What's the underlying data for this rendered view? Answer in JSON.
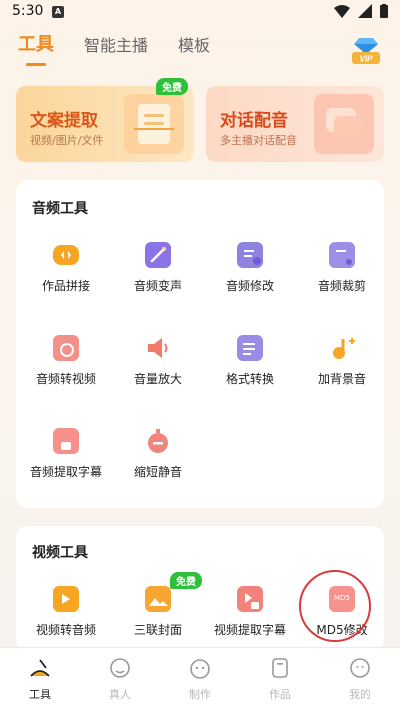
{
  "status": {
    "time": "5:30",
    "notif": "A"
  },
  "tabs": [
    {
      "label": "工具",
      "active": true
    },
    {
      "label": "智能主播"
    },
    {
      "label": "模板"
    }
  ],
  "vip": {
    "label": "VIP"
  },
  "features": [
    {
      "title": "文案提取",
      "subtitle": "视频/图片/文件",
      "badge": "免费"
    },
    {
      "title": "对话配音",
      "subtitle": "多主播对话配音"
    }
  ],
  "audio_tools": {
    "title": "音频工具",
    "items": [
      {
        "label": "作品拼接",
        "icon": "merge-icon"
      },
      {
        "label": "音频变声",
        "icon": "magic-wand-icon"
      },
      {
        "label": "音频修改",
        "icon": "audio-edit-icon"
      },
      {
        "label": "音频裁剪",
        "icon": "audio-cut-icon"
      },
      {
        "label": "音频转视频",
        "icon": "audio-to-video-icon"
      },
      {
        "label": "音量放大",
        "icon": "speaker-icon"
      },
      {
        "label": "格式转换",
        "icon": "format-convert-icon"
      },
      {
        "label": "加背景音",
        "icon": "music-note-icon"
      },
      {
        "label": "音频提取字幕",
        "icon": "audio-subtitle-icon"
      },
      {
        "label": "缩短静音",
        "icon": "timer-icon"
      }
    ]
  },
  "video_tools": {
    "title": "视频工具",
    "items": [
      {
        "label": "视频转音频",
        "icon": "video-to-audio-icon"
      },
      {
        "label": "三联封面",
        "icon": "cover-icon",
        "badge": "免费"
      },
      {
        "label": "视频提取字幕",
        "icon": "video-subtitle-icon"
      },
      {
        "label": "MD5修改",
        "icon": "md5-icon",
        "icon_text": "MD5"
      }
    ]
  },
  "nav": [
    {
      "label": "工具",
      "active": true
    },
    {
      "label": "真人"
    },
    {
      "label": "制作"
    },
    {
      "label": "作品"
    },
    {
      "label": "我的"
    }
  ],
  "colors": {
    "accent": "#f08a1e",
    "free_badge": "#2fbf3b",
    "highlight_ring": "#d93a3a"
  }
}
